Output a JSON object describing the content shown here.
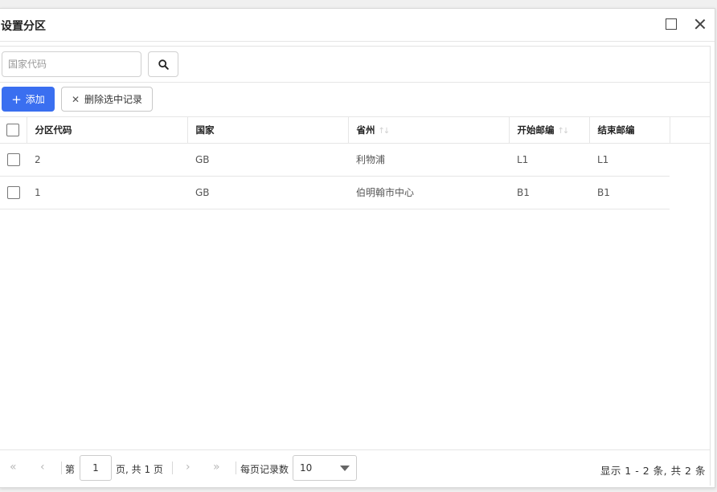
{
  "dialog": {
    "title": "设置分区",
    "maximize_icon": "maximize-icon",
    "close_icon": "close-icon"
  },
  "search": {
    "placeholder": "国家代码",
    "value": "",
    "button_icon": "search-icon"
  },
  "toolbar": {
    "add_label": "添加",
    "add_icon": "+",
    "delete_label": "删除选中记录",
    "delete_icon": "✕"
  },
  "table": {
    "columns": [
      {
        "label": "分区代码",
        "sortable": false
      },
      {
        "label": "国家",
        "sortable": false
      },
      {
        "label": "省州",
        "sortable": true
      },
      {
        "label": "开始邮编",
        "sortable": true
      },
      {
        "label": "结束邮编",
        "sortable": false
      }
    ],
    "sort_glyph": "↑↓",
    "rows": [
      {
        "code": "2",
        "country": "GB",
        "province": "利物浦",
        "start_zip": "L1",
        "end_zip": "L1"
      },
      {
        "code": "1",
        "country": "GB",
        "province": "伯明翰市中心",
        "start_zip": "B1",
        "end_zip": "B1"
      }
    ]
  },
  "pager": {
    "first_icon": "«",
    "prev_icon": "‹",
    "next_icon": "›",
    "last_icon": "»",
    "page_prefix": "第",
    "current_page": "1",
    "page_suffix": "页, 共 1 页",
    "page_size_label": "每页记录数",
    "page_size": "10",
    "summary": "显示 1 - 2 条, 共 2 条"
  },
  "colors": {
    "primary": "#3a6ff0",
    "border": "#e6e6e6"
  }
}
